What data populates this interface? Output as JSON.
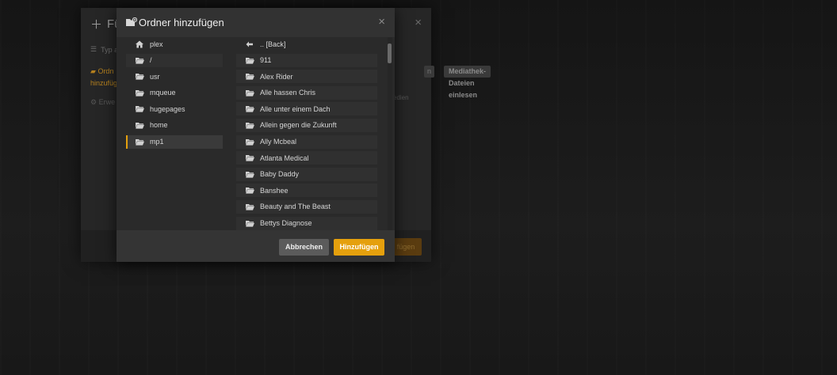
{
  "parent_modal": {
    "title": "Füg",
    "type_label": "Typ a",
    "folder_text_1": "Ordn",
    "folder_text_2": "hinzufüg",
    "gear_text": "Erwe",
    "btn_partial": "n",
    "scan_button": "Mediathek-Dateien einlesen",
    "note_partial": "edien",
    "add_partial": "fügen"
  },
  "dialog": {
    "title": "Ordner hinzufügen",
    "close_symbol": "×",
    "cancel_label": "Abbrechen",
    "add_label": "Hinzufügen"
  },
  "left_list": [
    {
      "label": "plex",
      "icon": "home-icon"
    },
    {
      "label": "/",
      "icon": "folder-icon"
    },
    {
      "label": "usr",
      "icon": "folder-icon"
    },
    {
      "label": "mqueue",
      "icon": "folder-icon"
    },
    {
      "label": "hugepages",
      "icon": "folder-icon"
    },
    {
      "label": "home",
      "icon": "folder-icon"
    },
    {
      "label": "mp1",
      "icon": "folder-icon",
      "selected": true
    }
  ],
  "right_list": [
    {
      "label": ".. [Back]",
      "icon": "back-arrow-icon"
    },
    {
      "label": "911",
      "icon": "folder-icon"
    },
    {
      "label": "Alex Rider",
      "icon": "folder-icon"
    },
    {
      "label": "Alle hassen Chris",
      "icon": "folder-icon"
    },
    {
      "label": "Alle unter einem Dach",
      "icon": "folder-icon"
    },
    {
      "label": "Allein gegen die Zukunft",
      "icon": "folder-icon"
    },
    {
      "label": "Ally Mcbeal",
      "icon": "folder-icon"
    },
    {
      "label": "Atlanta Medical",
      "icon": "folder-icon"
    },
    {
      "label": "Baby Daddy",
      "icon": "folder-icon"
    },
    {
      "label": "Banshee",
      "icon": "folder-icon"
    },
    {
      "label": "Beauty and The Beast",
      "icon": "folder-icon"
    },
    {
      "label": "Bettys Diagnose",
      "icon": "folder-icon"
    },
    {
      "label": "",
      "icon": "folder-icon"
    }
  ],
  "colors": {
    "accent": "#e5a00d",
    "background": "#1b1b1b",
    "dialog": "#2a2a2a"
  }
}
